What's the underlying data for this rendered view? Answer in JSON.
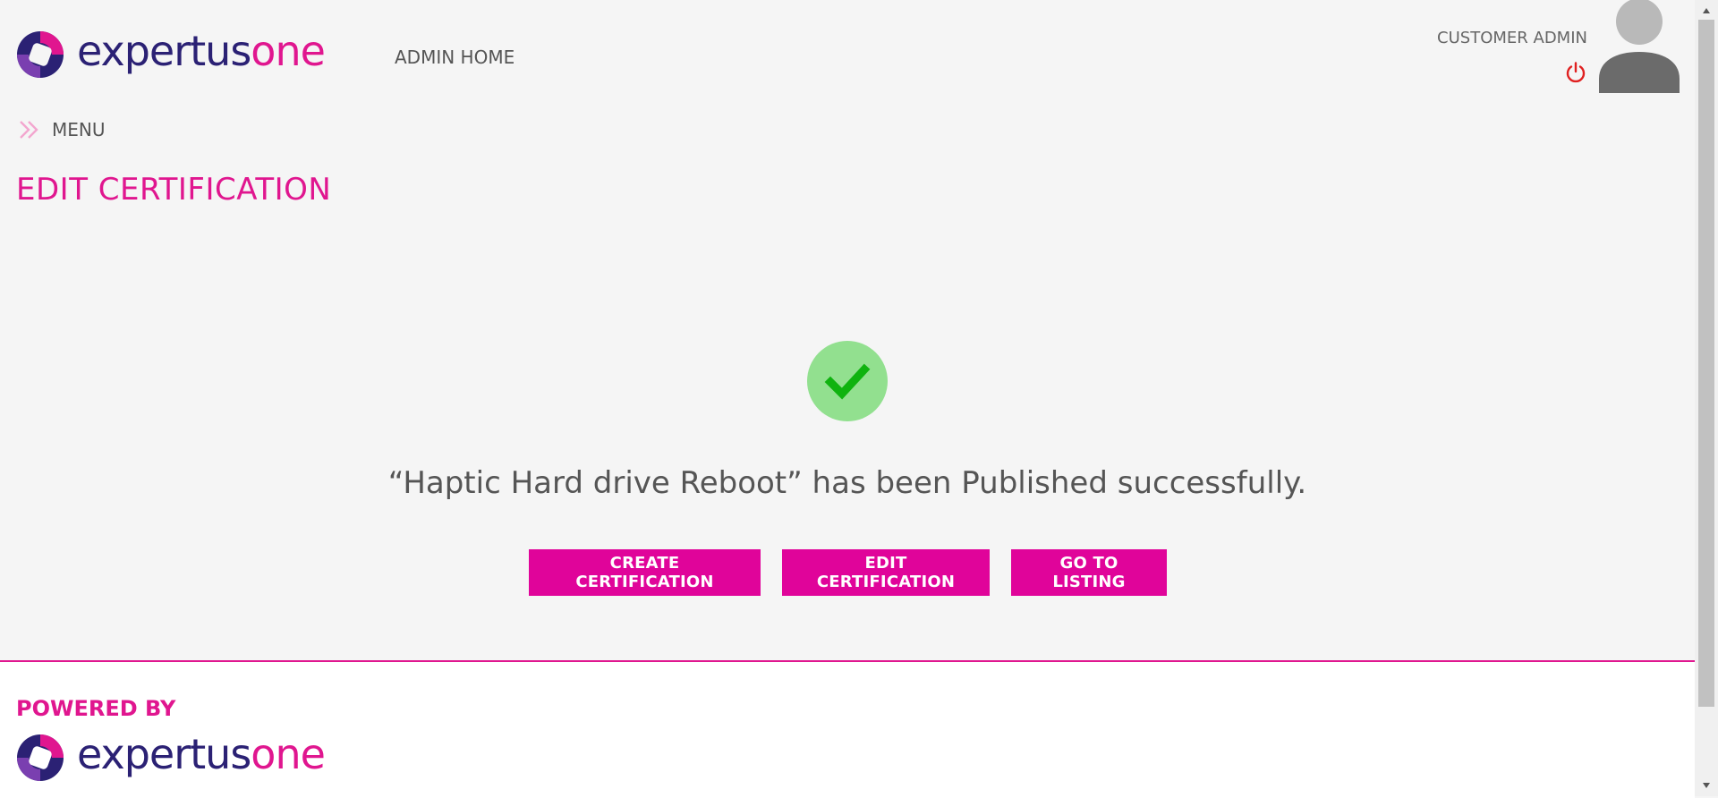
{
  "header": {
    "brand_part1": "expertus",
    "brand_part2": "one",
    "admin_home_label": "ADMIN HOME",
    "user_role": "CUSTOMER ADMIN"
  },
  "menu": {
    "label": "MENU"
  },
  "page": {
    "title": "EDIT CERTIFICATION"
  },
  "success": {
    "message": "“Haptic Hard drive Reboot” has been Published successfully."
  },
  "actions": {
    "create_label": "CREATE CERTIFICATION",
    "edit_label": "EDIT CERTIFICATION",
    "listing_label": "GO TO LISTING"
  },
  "footer": {
    "powered_by": "POWERED BY",
    "brand_part1": "expertus",
    "brand_part2": "one"
  },
  "colors": {
    "brand_pink": "#e0168f",
    "brand_navy": "#2b2174",
    "button_bg": "#e0049a",
    "success_circle": "#92e08f",
    "success_check": "#0fb30f",
    "power_icon": "#e02020"
  },
  "icons": [
    "logo-mark-icon",
    "power-icon",
    "avatar-icon",
    "double-chevron-right-icon",
    "check-circle-icon",
    "scroll-up-icon",
    "scroll-down-icon"
  ]
}
